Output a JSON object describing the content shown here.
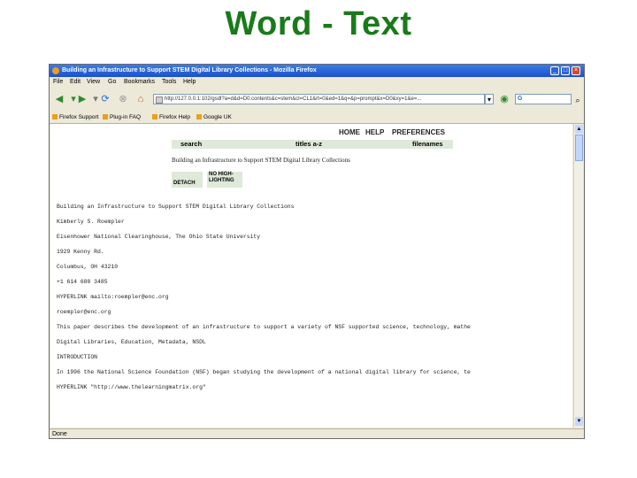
{
  "slide": {
    "title": "Word - Text"
  },
  "browser": {
    "window_title": "Building an Infrastructure to Support STEM Digital Library Collections - Mozilla Firefox",
    "menu": [
      "File",
      "Edit",
      "View",
      "Go",
      "Bookmarks",
      "Tools",
      "Help"
    ],
    "url": "http://127.0.0.1:102/gsdl?a=d&d=D0.contents&c=stem&cl=CL1&rt=0&ed=1&q=&p=prompt&x=D0&xy=1&e=...",
    "search_box": "G",
    "bookmarks": [
      "Firefox Support",
      "Plug-in FAQ",
      "Firefox Help",
      "Google UK"
    ],
    "status": "Done",
    "window_buttons": {
      "minimize": "_",
      "maximize": "□",
      "close": "×"
    }
  },
  "page": {
    "nav": {
      "home": "HOME",
      "help": "HELP",
      "preferences": "PREFERENCES"
    },
    "tabs": {
      "search": "search",
      "titles": "titles a-z",
      "filenames": "filenames"
    },
    "doc_title": "Building an Infrastructure to Support STEM Digital Library Collections",
    "buttons": {
      "detach": "DETACH",
      "no_highlighting": "NO HIGH-LIGHTING"
    },
    "lines": [
      "Building an Infrastructure to Support STEM Digital Library Collections",
      "Kimberly S. Roempler",
      "Eisenhower National Clearinghouse, The Ohio State University",
      "1929 Kenny Rd.",
      "Columbus, OH  43210",
      "+1 614 688 3485",
      " HYPERLINK mailto:roempler@enc.org",
      "roempler@enc.org",
      "This paper describes the development of an infrastructure to support a variety of NSF supported science, technology, mathe",
      "Digital Libraries, Education, Metadata, NSDL",
      "INTRODUCTION",
      "In 1996 the National Science Foundation (NSF) began studying the development of a national digital library for science, te",
      " HYPERLINK \"http://www.thelearningmatrix.org\""
    ]
  }
}
